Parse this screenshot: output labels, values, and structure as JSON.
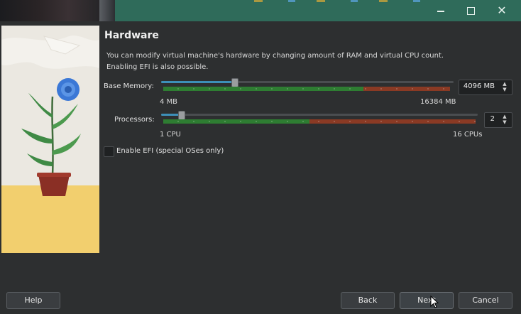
{
  "window": {
    "buttons": {
      "minimize": "minimize",
      "maximize": "maximize",
      "close": "✕"
    }
  },
  "page": {
    "title": "Hardware",
    "description_line1": "You can modify virtual machine's hardware by changing amount of RAM and virtual CPU count.",
    "description_line2": "Enabling EFI is also possible."
  },
  "memory": {
    "label": "Base Memory:",
    "value": "4096 MB",
    "min_label": "4 MB",
    "max_label": "16384 MB",
    "level_percent": 25
  },
  "processors": {
    "label": "Processors:",
    "value": "2",
    "min_label": "1 CPU",
    "max_label": "16 CPUs",
    "level_percent": 6.25
  },
  "efi": {
    "label": "Enable EFI (special OSes only)",
    "checked": false
  },
  "buttons": {
    "help": "Help",
    "back": "Back",
    "next": "Next",
    "cancel": "Cancel"
  },
  "colors": {
    "titlebar": "#2f6b5a",
    "slider_accent": "#3d8fb8",
    "range_green": "#2e7d32",
    "range_red": "#8a3a24"
  }
}
